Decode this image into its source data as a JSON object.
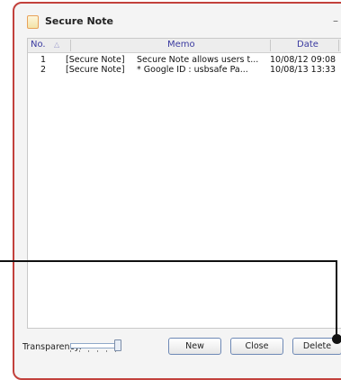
{
  "window": {
    "title": "Secure Note",
    "icon": "note-icon",
    "minimize_label": "–"
  },
  "list": {
    "columns": {
      "no": "No.",
      "sort_indicator": "△",
      "memo": "Memo",
      "date": "Date"
    },
    "rows": [
      {
        "no": "1",
        "type": "[Secure Note]",
        "memo": "Secure Note allows users t...",
        "date": "10/08/12  09:08"
      },
      {
        "no": "2",
        "type": "[Secure Note]",
        "memo": "* Google    ID : usbsafe  Pa...",
        "date": "10/08/13  13:33"
      }
    ]
  },
  "bottom": {
    "transparency_label": "Transparency:",
    "transparency_level": 1.0,
    "new_label": "New",
    "close_label": "Close",
    "delete_label": "Delete"
  },
  "colors": {
    "window_border": "#c2413c",
    "header_text": "#3a3aa0",
    "button_border": "#6e89b6"
  }
}
